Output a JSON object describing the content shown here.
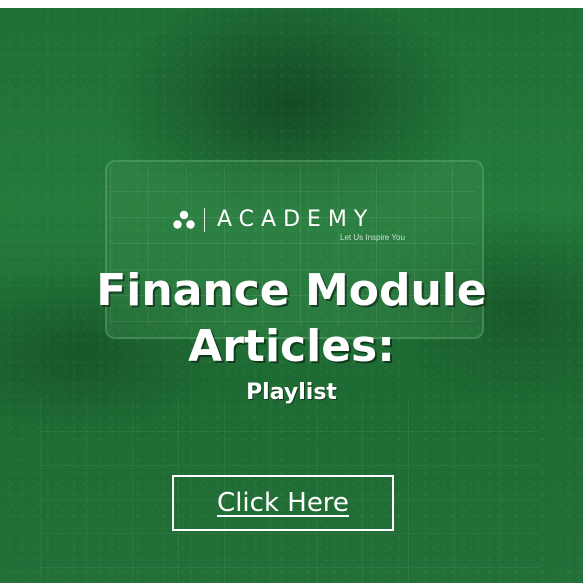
{
  "brand": {
    "name": "ACADEMY",
    "tagline": "Let Us Inspire You",
    "logo_icon": "academy-logo-icon"
  },
  "headline": {
    "line1": "Finance Module",
    "line2": "Articles:",
    "subtitle": "Playlist"
  },
  "cta": {
    "label": "Click Here"
  },
  "colors": {
    "background": "#1f6b33",
    "text": "#ffffff"
  }
}
